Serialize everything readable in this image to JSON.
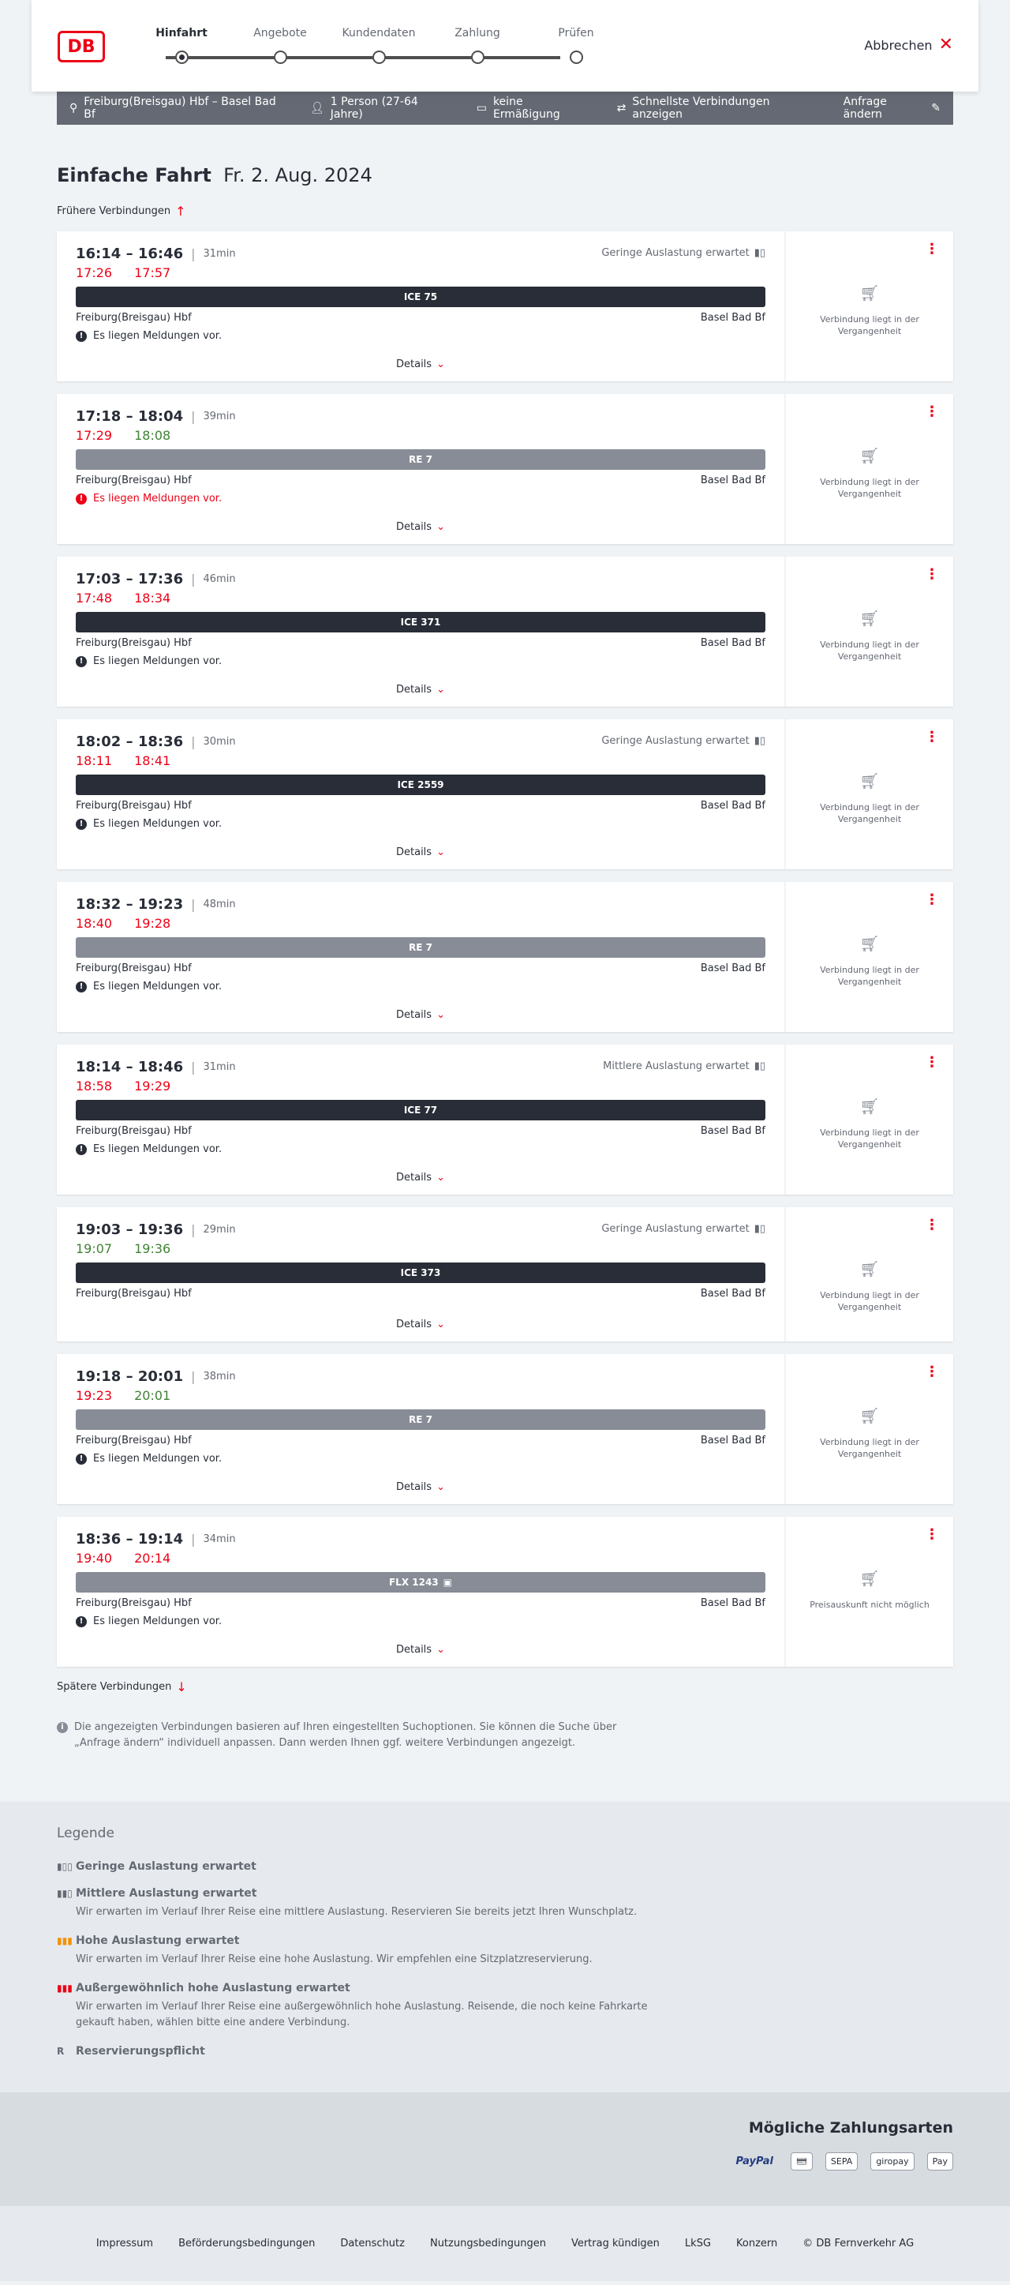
{
  "header": {
    "logo": "DB",
    "steps": [
      {
        "label": "Hinfahrt",
        "active": true
      },
      {
        "label": "Angebote",
        "active": false
      },
      {
        "label": "Kundendaten",
        "active": false
      },
      {
        "label": "Zahlung",
        "active": false
      },
      {
        "label": "Prüfen",
        "active": false
      }
    ],
    "cancel_label": "Abbrechen"
  },
  "summary": {
    "route": "Freiburg(Breisgau) Hbf – Basel Bad Bf",
    "passengers": "1 Person (27-64 Jahre)",
    "discount": "keine Ermäßigung",
    "fastest": "Schnellste Verbindungen anzeigen",
    "edit": "Anfrage ändern"
  },
  "main": {
    "title": "Einfache Fahrt",
    "date": "Fr. 2. Aug. 2024",
    "earlier": "Frühere Verbindungen",
    "later": "Spätere Verbindungen",
    "details_label": "Details",
    "hint": "Die angezeigten Verbindungen basieren auf Ihren eingestellten Suchoptionen. Sie können die Suche über „Anfrage ändern“ individuell anpassen. Dann werden Ihnen ggf. weitere Verbindungen angezeigt."
  },
  "connections": [
    {
      "times": "16:14 – 16:46",
      "duration": "31min",
      "load": "Geringe Auslastung erwartet",
      "rt_dep": "17:26",
      "rt_arr": "17:57",
      "dep_late": true,
      "arr_late": true,
      "train": "ICE 75",
      "bar": "dark",
      "from": "Freiburg(Breisgau) Hbf",
      "to": "Basel Bad Bf",
      "message": "Es liegen Meldungen vor.",
      "msg_red": false,
      "price_text": "Verbindung liegt in der Vergangenheit"
    },
    {
      "times": "17:18 – 18:04",
      "duration": "39min",
      "load": "",
      "rt_dep": "17:29",
      "rt_arr": "18:08",
      "dep_late": true,
      "arr_late": false,
      "train": "RE 7",
      "bar": "grey",
      "from": "Freiburg(Breisgau) Hbf",
      "to": "Basel Bad Bf",
      "message": "Es liegen Meldungen vor.",
      "msg_red": true,
      "price_text": "Verbindung liegt in der Vergangenheit"
    },
    {
      "times": "17:03 – 17:36",
      "duration": "46min",
      "load": "",
      "rt_dep": "17:48",
      "rt_arr": "18:34",
      "dep_late": true,
      "arr_late": true,
      "train": "ICE 371",
      "bar": "dark",
      "from": "Freiburg(Breisgau) Hbf",
      "to": "Basel Bad Bf",
      "message": "Es liegen Meldungen vor.",
      "msg_red": false,
      "price_text": "Verbindung liegt in der Vergangenheit"
    },
    {
      "times": "18:02 – 18:36",
      "duration": "30min",
      "load": "Geringe Auslastung erwartet",
      "rt_dep": "18:11",
      "rt_arr": "18:41",
      "dep_late": true,
      "arr_late": true,
      "train": "ICE 2559",
      "bar": "dark",
      "from": "Freiburg(Breisgau) Hbf",
      "to": "Basel Bad Bf",
      "message": "Es liegen Meldungen vor.",
      "msg_red": false,
      "price_text": "Verbindung liegt in der Vergangenheit"
    },
    {
      "times": "18:32 – 19:23",
      "duration": "48min",
      "load": "",
      "rt_dep": "18:40",
      "rt_arr": "19:28",
      "dep_late": true,
      "arr_late": true,
      "train": "RE 7",
      "bar": "grey",
      "from": "Freiburg(Breisgau) Hbf",
      "to": "Basel Bad Bf",
      "message": "Es liegen Meldungen vor.",
      "msg_red": false,
      "price_text": "Verbindung liegt in der Vergangenheit"
    },
    {
      "times": "18:14 – 18:46",
      "duration": "31min",
      "load": "Mittlere Auslastung erwartet",
      "rt_dep": "18:58",
      "rt_arr": "19:29",
      "dep_late": true,
      "arr_late": true,
      "train": "ICE 77",
      "bar": "dark",
      "from": "Freiburg(Breisgau) Hbf",
      "to": "Basel Bad Bf",
      "message": "Es liegen Meldungen vor.",
      "msg_red": false,
      "price_text": "Verbindung liegt in der Vergangenheit"
    },
    {
      "times": "19:03 – 19:36",
      "duration": "29min",
      "load": "Geringe Auslastung erwartet",
      "rt_dep": "19:07",
      "rt_arr": "19:36",
      "dep_late": false,
      "arr_late": false,
      "train": "ICE 373",
      "bar": "dark",
      "from": "Freiburg(Breisgau) Hbf",
      "to": "Basel Bad Bf",
      "message": "",
      "msg_red": false,
      "price_text": "Verbindung liegt in der Vergangenheit"
    },
    {
      "times": "19:18 – 20:01",
      "duration": "38min",
      "load": "",
      "rt_dep": "19:23",
      "rt_arr": "20:01",
      "dep_late": true,
      "arr_late": false,
      "train": "RE 7",
      "bar": "grey",
      "from": "Freiburg(Breisgau) Hbf",
      "to": "Basel Bad Bf",
      "message": "Es liegen Meldungen vor.",
      "msg_red": false,
      "price_text": "Verbindung liegt in der Vergangenheit"
    },
    {
      "times": "18:36 – 19:14",
      "duration": "34min",
      "load": "",
      "rt_dep": "19:40",
      "rt_arr": "20:14",
      "dep_late": true,
      "arr_late": true,
      "train": "FLX 1243",
      "bar": "grey",
      "from": "Freiburg(Breisgau) Hbf",
      "to": "Basel Bad Bf",
      "message": "Es liegen Meldungen vor.",
      "msg_red": false,
      "price_text": "Preisauskunft nicht möglich"
    }
  ],
  "legend": {
    "title": "Legende",
    "items": [
      {
        "title": "Geringe Auslastung erwartet",
        "desc": "",
        "color": "#646973",
        "icon": "▮▯▯"
      },
      {
        "title": "Mittlere Auslastung erwartet",
        "desc": "Wir erwarten im Verlauf Ihrer Reise eine mittlere Auslastung. Reservieren Sie bereits jetzt Ihren Wunschplatz.",
        "color": "#646973",
        "icon": "▮▮▯"
      },
      {
        "title": "Hohe Auslastung erwartet",
        "desc": "Wir erwarten im Verlauf Ihrer Reise eine hohe Auslastung. Wir empfehlen eine Sitzplatzreservierung.",
        "color": "#f39200",
        "icon": "▮▮▮"
      },
      {
        "title": "Außergewöhnlich hohe Auslastung erwartet",
        "desc": "Wir erwarten im Verlauf Ihrer Reise eine außergewöhnlich hohe Auslastung. Reisende, die noch keine Fahrkarte gekauft haben, wählen bitte eine andere Verbindung.",
        "color": "#ec0016",
        "icon": "▮▮▮"
      },
      {
        "title": "Reservierungspflicht",
        "desc": "",
        "color": "#646973",
        "icon": "R"
      }
    ]
  },
  "payment": {
    "title": "Mögliche Zahlungsarten",
    "methods": [
      "PayPal",
      "Kreditkarte",
      "SEPA",
      "giropay",
      "Apple Pay"
    ]
  },
  "footer": {
    "links": [
      "Impressum",
      "Beförderungsbedingungen",
      "Datenschutz",
      "Nutzungsbedingungen",
      "Vertrag kündigen",
      "LkSG",
      "Konzern",
      "© DB Fernverkehr AG"
    ]
  }
}
